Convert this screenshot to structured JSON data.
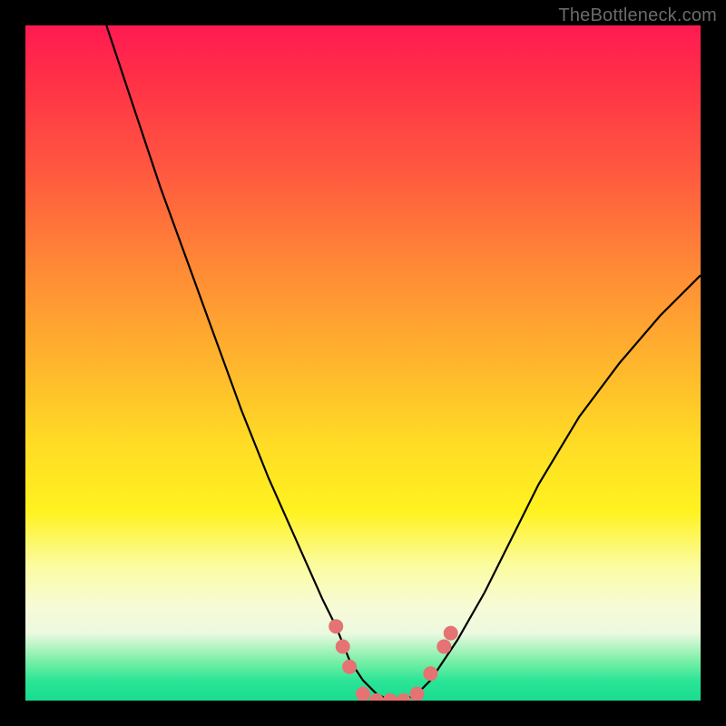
{
  "watermark": "TheBottleneck.com",
  "chart_data": {
    "type": "line",
    "title": "",
    "xlabel": "",
    "ylabel": "",
    "xlim": [
      0,
      100
    ],
    "ylim": [
      0,
      100
    ],
    "series": [
      {
        "name": "bottleneck-curve",
        "x": [
          12,
          16,
          20,
          24,
          28,
          32,
          36,
          40,
          44,
          46,
          48,
          50,
          52,
          54,
          56,
          58,
          60,
          64,
          68,
          72,
          76,
          82,
          88,
          94,
          100
        ],
        "y": [
          100,
          88,
          76,
          65,
          54,
          43,
          33,
          24,
          15,
          11,
          6,
          3,
          1,
          0,
          0,
          1,
          3,
          9,
          16,
          24,
          32,
          42,
          50,
          57,
          63
        ]
      }
    ],
    "markers": {
      "name": "highlight-dots",
      "color": "#e57373",
      "points": [
        {
          "x": 46,
          "y": 11
        },
        {
          "x": 47,
          "y": 8
        },
        {
          "x": 48,
          "y": 5
        },
        {
          "x": 50,
          "y": 1
        },
        {
          "x": 52,
          "y": 0
        },
        {
          "x": 54,
          "y": 0
        },
        {
          "x": 56,
          "y": 0
        },
        {
          "x": 58,
          "y": 1
        },
        {
          "x": 60,
          "y": 4
        },
        {
          "x": 62,
          "y": 8
        },
        {
          "x": 63,
          "y": 10
        }
      ]
    }
  }
}
